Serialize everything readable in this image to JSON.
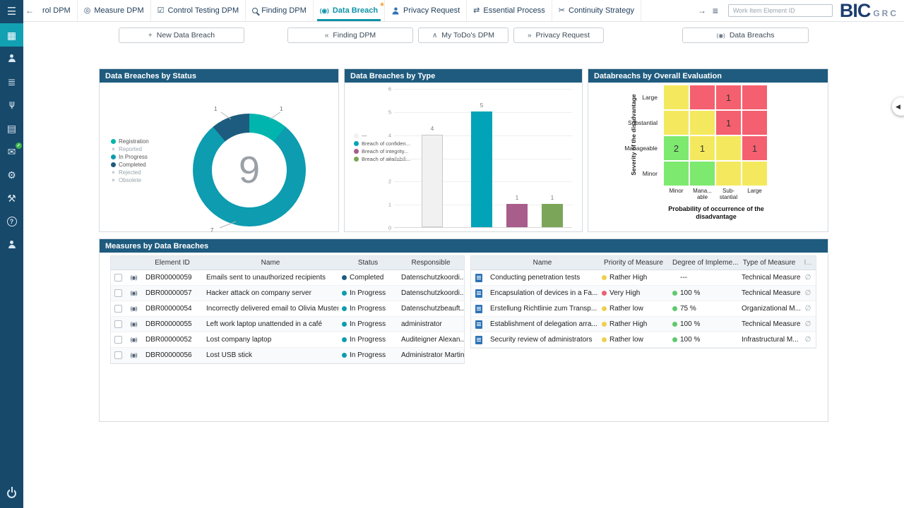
{
  "icons": {
    "menu": "☰",
    "dashboard": "▦",
    "tasks": "≣",
    "hierarchy": "⋔",
    "document": "▤",
    "mail": "✉",
    "process": "⚙",
    "tools": "⚒",
    "help": "?",
    "data_breach": "(◉)",
    "star": "★",
    "empty_set": "∅",
    "x": "×",
    "scroll_left": "←",
    "scroll_right": "→",
    "list_menu": "≡",
    "expand": "◀",
    "check": "✓",
    "measure": "◎",
    "control_testing": "☑",
    "essential_process": "⇄",
    "continuity_strategy": "✂",
    "plus": "+",
    "chevrons_left": "«",
    "chevron_up": "∧",
    "chevrons_right": "»"
  },
  "topbar": {
    "tabs": [
      {
        "label": "rol DPM"
      },
      {
        "label": "Measure DPM"
      },
      {
        "label": "Control Testing DPM"
      },
      {
        "label": "Finding DPM"
      },
      {
        "label": "Data Breach",
        "active": true
      },
      {
        "label": "Privacy Request"
      },
      {
        "label": "Essential Process"
      },
      {
        "label": "Continuity Strategy"
      }
    ],
    "work_item_placeholder": "Work Item Element ID",
    "logo_main": "BIC",
    "logo_sub": "GRC"
  },
  "toolbar": {
    "buttons": [
      {
        "label": "New Data Breach"
      },
      {
        "label": "Finding DPM"
      },
      {
        "label": "My ToDo's DPM"
      },
      {
        "label": "Privacy Request"
      },
      {
        "label": "Data Breachs"
      }
    ]
  },
  "chart_data": [
    {
      "type": "pie",
      "donut": true,
      "title": "Data Breaches by Status",
      "total": 9,
      "series": [
        {
          "name": "Registration",
          "value": 1,
          "color": "#00b5ad"
        },
        {
          "name": "In Progress",
          "value": 7,
          "color": "#0d9cb0"
        },
        {
          "name": "Completed",
          "value": 1,
          "color": "#1d5c7e"
        }
      ],
      "legend": [
        {
          "label": "Registration",
          "color": "#00b5ad",
          "enabled": true
        },
        {
          "label": "Reported",
          "enabled": false
        },
        {
          "label": "In Progress",
          "color": "#0d9cb0",
          "enabled": true
        },
        {
          "label": "Completed",
          "color": "#1d5c7e",
          "enabled": true
        },
        {
          "label": "Rejected",
          "enabled": false
        },
        {
          "label": "Obsolete",
          "enabled": false
        }
      ],
      "callouts": [
        {
          "series": "Completed",
          "value": 1
        },
        {
          "series": "Registration",
          "value": 1
        },
        {
          "series": "In Progress",
          "value": 7
        }
      ]
    },
    {
      "type": "bar",
      "title": "Data Breaches by Type",
      "categories": [
        "---",
        "Breach of confiden...",
        "Breach of integrity...",
        "Breach of availabili..."
      ],
      "values": [
        4,
        5,
        1,
        1
      ],
      "colors": [
        "#f1f1f1",
        "#00a3b8",
        "#a85d8a",
        "#7ba659"
      ],
      "bar_borders": [
        "#c9c9c9",
        "#00a3b8",
        "#a85d8a",
        "#7ba659"
      ],
      "ylim": [
        0,
        6
      ],
      "yticks": [
        0,
        1,
        2,
        3,
        4,
        5,
        6
      ],
      "legend_position": "left"
    },
    {
      "type": "heatmap",
      "title": "Databreachs by Overall Evaluation",
      "xlabel": "Probability of occurrence of the disadvantage",
      "ylabel": "Severity of the disadvantage",
      "row_labels": [
        "Large",
        "Substantial",
        "Manageable",
        "Minor"
      ],
      "col_labels": [
        [
          "Minor",
          ""
        ],
        [
          "Mana...",
          "able"
        ],
        [
          "Sub-",
          "stantial"
        ],
        [
          "Large",
          ""
        ]
      ],
      "cells": [
        [
          {
            "value": "",
            "color": "#f4e95e"
          },
          {
            "value": "",
            "color": "#f4606f"
          },
          {
            "value": "1",
            "color": "#f4606f"
          },
          {
            "value": "",
            "color": "#f4606f"
          }
        ],
        [
          {
            "value": "",
            "color": "#f4e95e"
          },
          {
            "value": "",
            "color": "#f4e95e"
          },
          {
            "value": "1",
            "color": "#f4606f"
          },
          {
            "value": "",
            "color": "#f4606f"
          }
        ],
        [
          {
            "value": "2",
            "color": "#7de96f"
          },
          {
            "value": "1",
            "color": "#f4e95e"
          },
          {
            "value": "",
            "color": "#f4e95e"
          },
          {
            "value": "1",
            "color": "#f4606f"
          }
        ],
        [
          {
            "value": "",
            "color": "#7de96f"
          },
          {
            "value": "",
            "color": "#7de96f"
          },
          {
            "value": "",
            "color": "#f4e95e"
          },
          {
            "value": "",
            "color": "#f4e95e"
          }
        ]
      ]
    }
  ],
  "measures": {
    "title": "Measures by Data Breaches",
    "left": {
      "columns": [
        "Element ID",
        "Name",
        "Status",
        "Responsible"
      ],
      "rows": [
        {
          "id": "DBR00000059",
          "name": "Emails sent to unauthorized recipients",
          "status": "Completed",
          "status_color": "#1d5c7e",
          "responsible": "Datenschutzkoordi..."
        },
        {
          "id": "DBR00000057",
          "name": "Hacker attack on company server",
          "status": "In Progress",
          "status_color": "#0d9cb0",
          "responsible": "Datenschutzkoordi..."
        },
        {
          "id": "DBR00000054",
          "name": "Incorrectly delivered email to Olivia Musterfrau",
          "status": "In Progress",
          "status_color": "#0d9cb0",
          "responsible": "Datenschutzbeauft..."
        },
        {
          "id": "DBR00000055",
          "name": "Left work laptop unattended in a café",
          "status": "In Progress",
          "status_color": "#0d9cb0",
          "responsible": "administrator"
        },
        {
          "id": "DBR00000052",
          "name": "Lost company laptop",
          "status": "In Progress",
          "status_color": "#0d9cb0",
          "responsible": "Auditeigner Alexan..."
        },
        {
          "id": "DBR00000056",
          "name": "Lost USB stick",
          "status": "In Progress",
          "status_color": "#0d9cb0",
          "responsible": "Administrator Martin"
        }
      ]
    },
    "right": {
      "columns": [
        "Name",
        "Priority of Measure",
        "Degree of Impleme...",
        "Type of Measure",
        "I..."
      ],
      "rows": [
        {
          "name": "Conducting penetration tests",
          "priority": "Rather High",
          "priority_color": "#f0cf4e",
          "degree": "---",
          "degree_color": "transparent",
          "type": "Technical Measure"
        },
        {
          "name": "Encapsulation of devices in a Fa...",
          "priority": "Very High",
          "priority_color": "#ef5f70",
          "degree": "100 %",
          "degree_color": "#5fc96d",
          "type": "Technical Measure"
        },
        {
          "name": "Erstellung Richtlinie zum Transp...",
          "priority": "Rather low",
          "priority_color": "#f0cf4e",
          "degree": "75 %",
          "degree_color": "#5fc96d",
          "type": "Organizational M..."
        },
        {
          "name": "Establishment of delegation arra...",
          "priority": "Rather High",
          "priority_color": "#f0cf4e",
          "degree": "100 %",
          "degree_color": "#5fc96d",
          "type": "Technical Measure"
        },
        {
          "name": "Security review of administrators",
          "priority": "Rather low",
          "priority_color": "#f0cf4e",
          "degree": "100 %",
          "degree_color": "#5fc96d",
          "type": "Infrastructural M..."
        }
      ]
    }
  }
}
